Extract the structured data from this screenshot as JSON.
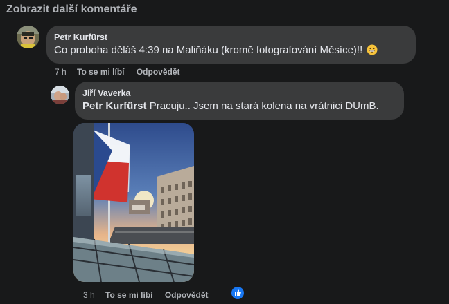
{
  "more_comments_label": "Zobrazit další komentáře",
  "comment1": {
    "author": "Petr Kurfürst",
    "text": "Co proboha děláš 4:39 na Maliňáku (kromě fotografování Měsíce)!!",
    "emoji": "grinning-face-emoji",
    "time": "7 h",
    "like_label": "To se mi líbí",
    "reply_label": "Odpovědět"
  },
  "reply1": {
    "author": "Jiří Vaverka",
    "mention": "Petr Kurfürst",
    "text": "Pracuju.. Jsem na stará kolena na vrátnici DUmB.",
    "time": "3 h",
    "like_label": "To se mi líbí",
    "reply_label": "Odpovědět",
    "reaction_icon": "like-reaction-icon",
    "photo_description_icon": "attached-photo"
  },
  "colors": {
    "background": "#18191a",
    "bubble": "#3a3b3c",
    "text": "#e4e6eb",
    "secondary_text": "#b0b3b8",
    "like_blue": "#1877f2"
  }
}
